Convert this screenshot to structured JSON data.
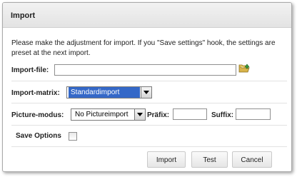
{
  "dialog": {
    "title": "Import",
    "intro": "Please make the adjustment for import. If you \"Save settings\" hook, the settings are preset at the next import."
  },
  "import_file": {
    "label": "Import-file:",
    "value": "",
    "browse_icon": "folder-open-icon"
  },
  "import_matrix": {
    "label": "Import-matrix:",
    "selected": "Standardimport"
  },
  "picture_modus": {
    "label": "Picture-modus:",
    "selected": "No Pictureimport",
    "prefix_label": "Präfix:",
    "prefix_value": "",
    "suffix_label": "Suffix:",
    "suffix_value": ""
  },
  "save_options": {
    "label": "Save Options",
    "checked": false
  },
  "buttons": {
    "import": "Import",
    "test": "Test",
    "cancel": "Cancel"
  },
  "colors": {
    "selection_highlight": "#3468c8",
    "titlebar": "#ebebeb",
    "folder_icon": "#d9b44a",
    "folder_arrow": "#3b9a3b"
  }
}
